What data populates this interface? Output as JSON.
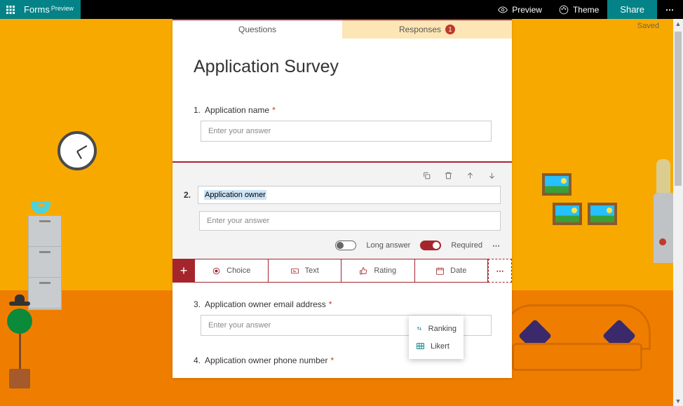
{
  "topbar": {
    "brand_name": "Forms",
    "brand_suffix": "Preview",
    "preview_label": "Preview",
    "theme_label": "Theme",
    "share_label": "Share"
  },
  "status": {
    "saved": "Saved"
  },
  "tabs": {
    "questions": "Questions",
    "responses": "Responses",
    "response_count": "1"
  },
  "form": {
    "title": "Application Survey",
    "q1": {
      "num": "1.",
      "label": "Application name",
      "placeholder": "Enter your answer",
      "required": "*"
    },
    "q2": {
      "num": "2.",
      "title": "Application owner",
      "placeholder": "Enter your answer",
      "long_answer_label": "Long answer",
      "required_label": "Required"
    },
    "q3": {
      "num": "3.",
      "label": "Application owner email address",
      "placeholder": "Enter your answer",
      "required": "*"
    },
    "q4": {
      "num": "4.",
      "label": "Application owner phone number",
      "required": "*"
    }
  },
  "addbar": {
    "choice": "Choice",
    "text": "Text",
    "rating": "Rating",
    "date": "Date"
  },
  "menu": {
    "ranking": "Ranking",
    "likert": "Likert"
  }
}
